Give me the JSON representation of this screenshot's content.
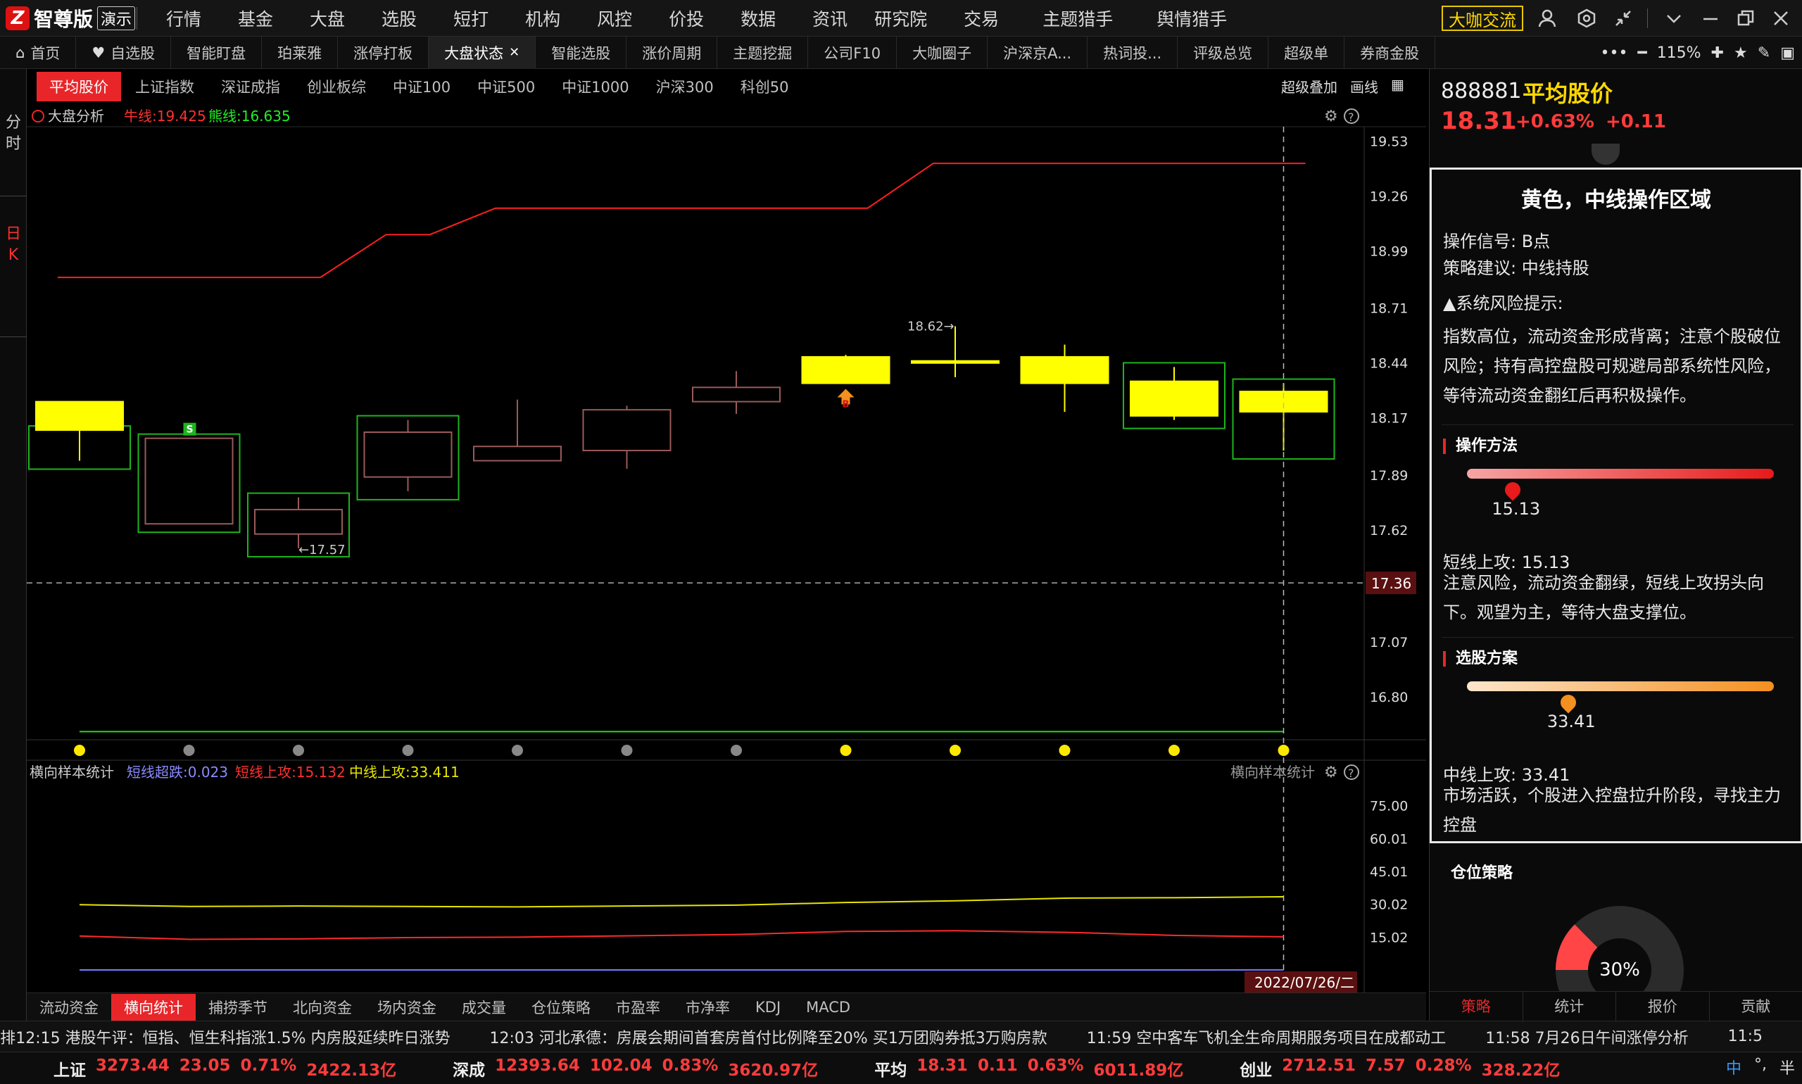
{
  "app": {
    "logo_mark": "Z",
    "name": "智尊版",
    "demo_badge": "演示"
  },
  "top_menu": [
    "行情",
    "基金",
    "大盘",
    "选股",
    "短打",
    "机构",
    "风控",
    "价投",
    "数据",
    "资讯",
    "研究院",
    "交易",
    "主题猎手",
    "舆情猎手"
  ],
  "dakafe": "大咖交流",
  "tabs": [
    {
      "label": "首页",
      "icon": "home-icon"
    },
    {
      "label": "自选股",
      "icon": "heart-icon"
    },
    {
      "label": "智能盯盘"
    },
    {
      "label": "珀莱雅"
    },
    {
      "label": "涨停打板"
    },
    {
      "label": "大盘状态",
      "active": true,
      "closable": true
    },
    {
      "label": "智能选股"
    },
    {
      "label": "涨价周期"
    },
    {
      "label": "主题挖掘"
    },
    {
      "label": "公司F10"
    },
    {
      "label": "大咖圈子"
    },
    {
      "label": "沪深京A..."
    },
    {
      "label": "热词投..."
    },
    {
      "label": "评级总览"
    },
    {
      "label": "超级单"
    },
    {
      "label": "券商金股"
    }
  ],
  "zoom": "115%",
  "left_col": {
    "fenshi": [
      "分",
      "时"
    ],
    "rik": [
      "日",
      "K"
    ]
  },
  "index_tabs": [
    "平均股价",
    "上证指数",
    "深证成指",
    "创业板综",
    "中证100",
    "中证500",
    "中证1000",
    "沪深300",
    "科创50"
  ],
  "index_tools": {
    "overlay": "超级叠加",
    "draw": "画线"
  },
  "chart_header": {
    "title": "大盘分析",
    "bull_label": "牛线:19.425",
    "bear_label": "熊线:16.635",
    "b_marker": "B",
    "s_marker": "S"
  },
  "sub_header": {
    "title": "横向样本统计",
    "short_drop": "短线超跌:0.023",
    "short_attack": "短线上攻:15.132",
    "mid_attack": "中线上攻:33.411",
    "right_title": "横向样本统计"
  },
  "date_label": "2022/07/26/二",
  "sub_tabs": [
    "流动资金",
    "横向统计",
    "捕捞季节",
    "北向资金",
    "场内资金",
    "成交量",
    "仓位策略",
    "市盈率",
    "市净率",
    "KDJ",
    "MACD"
  ],
  "colors": {
    "up": "#ff3b3b",
    "accent": "#e8262a",
    "yellow": "#ffff00",
    "box": "#1db51d"
  },
  "chart_data": [
    {
      "type": "candlestick",
      "title": "大盘分析",
      "ylim": [
        16.6,
        19.6
      ],
      "y_ticks": [
        "19.53",
        "19.26",
        "18.99",
        "18.71",
        "18.44",
        "18.17",
        "17.89",
        "17.62",
        "17.36",
        "17.07",
        "16.80"
      ],
      "current_price_label": "17.36",
      "candles": [
        {
          "o": 18.25,
          "c": 18.11,
          "h": 18.11,
          "l": 17.96,
          "fill": "yellow",
          "box": true
        },
        {
          "o": 18.07,
          "c": 17.65,
          "h": 18.07,
          "l": 17.65,
          "fill": "hollow",
          "box": true,
          "signal": "S"
        },
        {
          "o": 17.72,
          "c": 17.6,
          "h": 17.78,
          "l": 17.53,
          "fill": "hollow",
          "box": true
        },
        {
          "o": 18.1,
          "c": 17.88,
          "h": 18.16,
          "l": 17.81,
          "fill": "hollow",
          "box": true
        },
        {
          "o": 18.03,
          "c": 17.96,
          "h": 18.26,
          "l": 17.96,
          "fill": "hollow"
        },
        {
          "o": 18.21,
          "c": 18.01,
          "h": 18.23,
          "l": 17.92,
          "fill": "hollow"
        },
        {
          "o": 18.32,
          "c": 18.25,
          "h": 18.4,
          "l": 18.19,
          "fill": "hollow"
        },
        {
          "o": 18.47,
          "c": 18.34,
          "h": 18.48,
          "l": 18.34,
          "fill": "yellow",
          "signal": "B"
        },
        {
          "o": 18.45,
          "c": 18.44,
          "h": 18.62,
          "l": 18.37,
          "fill": "yellow"
        },
        {
          "o": 18.47,
          "c": 18.34,
          "h": 18.53,
          "l": 18.2,
          "fill": "yellow"
        },
        {
          "o": 18.35,
          "c": 18.18,
          "h": 18.42,
          "l": 18.16,
          "fill": "yellow",
          "box": true
        },
        {
          "o": 18.3,
          "c": 18.2,
          "h": 18.34,
          "l": 18.01,
          "fill": "yellow",
          "box": true
        }
      ],
      "high_label": "18.62→",
      "low_label": "←17.57",
      "bull_line": [
        18.86,
        18.86,
        18.86,
        19.07,
        19.2,
        19.2,
        19.2,
        19.2,
        19.42,
        19.42,
        19.42,
        19.42
      ],
      "bear_line": [
        16.63,
        16.63,
        16.63,
        16.63,
        16.63,
        16.63,
        16.63,
        16.63,
        16.63,
        16.63,
        16.63,
        16.63
      ],
      "dots": [
        "yellow",
        "gray",
        "gray",
        "gray",
        "gray",
        "gray",
        "gray",
        "yellow",
        "yellow",
        "yellow",
        "yellow",
        "yellow"
      ]
    },
    {
      "type": "line",
      "title": "横向样本统计",
      "ylim": [
        0,
        90
      ],
      "y_ticks": [
        "75.00",
        "60.01",
        "45.01",
        "30.02",
        "15.02"
      ],
      "series": [
        {
          "name": "短线超跌",
          "color": "#7b7bff",
          "values": [
            0.02,
            0.02,
            0.02,
            0.02,
            0.02,
            0.02,
            0.02,
            0.02,
            0.02,
            0.02,
            0.02,
            0.023
          ]
        },
        {
          "name": "短线上攻",
          "color": "#ff2a2a",
          "values": [
            15.5,
            14.0,
            14.2,
            14.8,
            15.0,
            15.6,
            16.2,
            17.6,
            17.9,
            17.2,
            15.8,
            15.13
          ]
        },
        {
          "name": "中线上攻",
          "color": "#e6e600",
          "values": [
            29.8,
            29.0,
            29.2,
            29.0,
            28.8,
            29.2,
            29.6,
            30.8,
            31.6,
            32.8,
            33.0,
            33.41
          ]
        }
      ]
    }
  ],
  "right": {
    "code": "888881",
    "name": "平均股价",
    "price": "18.31",
    "pct": "+0.63%",
    "chg": "+0.11",
    "tip": {
      "title": "黄色，中线操作区域",
      "signal": "操作信号: B点",
      "advice": "策略建议: 中线持股",
      "risk_title": "▲系统风险提示:",
      "risk_text": "指数高位，流动资金形成背离；注意个股破位风险；持有高控盘股可规避局部系统性风险，等待流动资金翻红后再积极操作。",
      "method_title": "操作方法",
      "method_val": "15.13",
      "method_level": 0.15,
      "short_line": "短线上攻: 15.13",
      "short_text": "注意风险，流动资金翻绿，短线上攻拐头向下。观望为主，等待大盘支撑位。",
      "select_title": "选股方案",
      "select_val": "33.41",
      "select_level": 0.33,
      "mid_line": "中线上攻: 33.41",
      "mid_text": "市场活跃，个股进入控盘拉升阶段，寻找主力控盘"
    },
    "position_title": "仓位策略",
    "position_pct": "30%",
    "position_value": 0.3,
    "tabs": [
      "策略",
      "统计",
      "报价",
      "贡献"
    ]
  },
  "news": {
    "lead": "排",
    "items": [
      "12:15 港股午评：恒指、恒生科指涨1.5% 内房股延续昨日涨势",
      "12:03 河北承德：房展会期间首套房首付比例降至20% 买1万团购券抵3万购房款",
      "11:59 空中客车飞机全生命周期服务项目在成都动工",
      "11:58 7月26日午间涨停分析",
      "11:5"
    ]
  },
  "status": [
    {
      "name": "上证",
      "val": "3273.44",
      "chg": "23.05",
      "pct": "0.71%",
      "amt": "2422.13亿"
    },
    {
      "name": "深成",
      "val": "12393.64",
      "chg": "102.04",
      "pct": "0.83%",
      "amt": "3620.97亿"
    },
    {
      "name": "平均",
      "val": "18.31",
      "chg": "0.11",
      "pct": "0.63%",
      "amt": "6011.89亿"
    },
    {
      "name": "创业",
      "val": "2712.51",
      "chg": "7.57",
      "pct": "0.28%",
      "amt": "328.22亿"
    }
  ],
  "ime": {
    "lang": "中",
    "punct": "°,",
    "width": "半"
  }
}
